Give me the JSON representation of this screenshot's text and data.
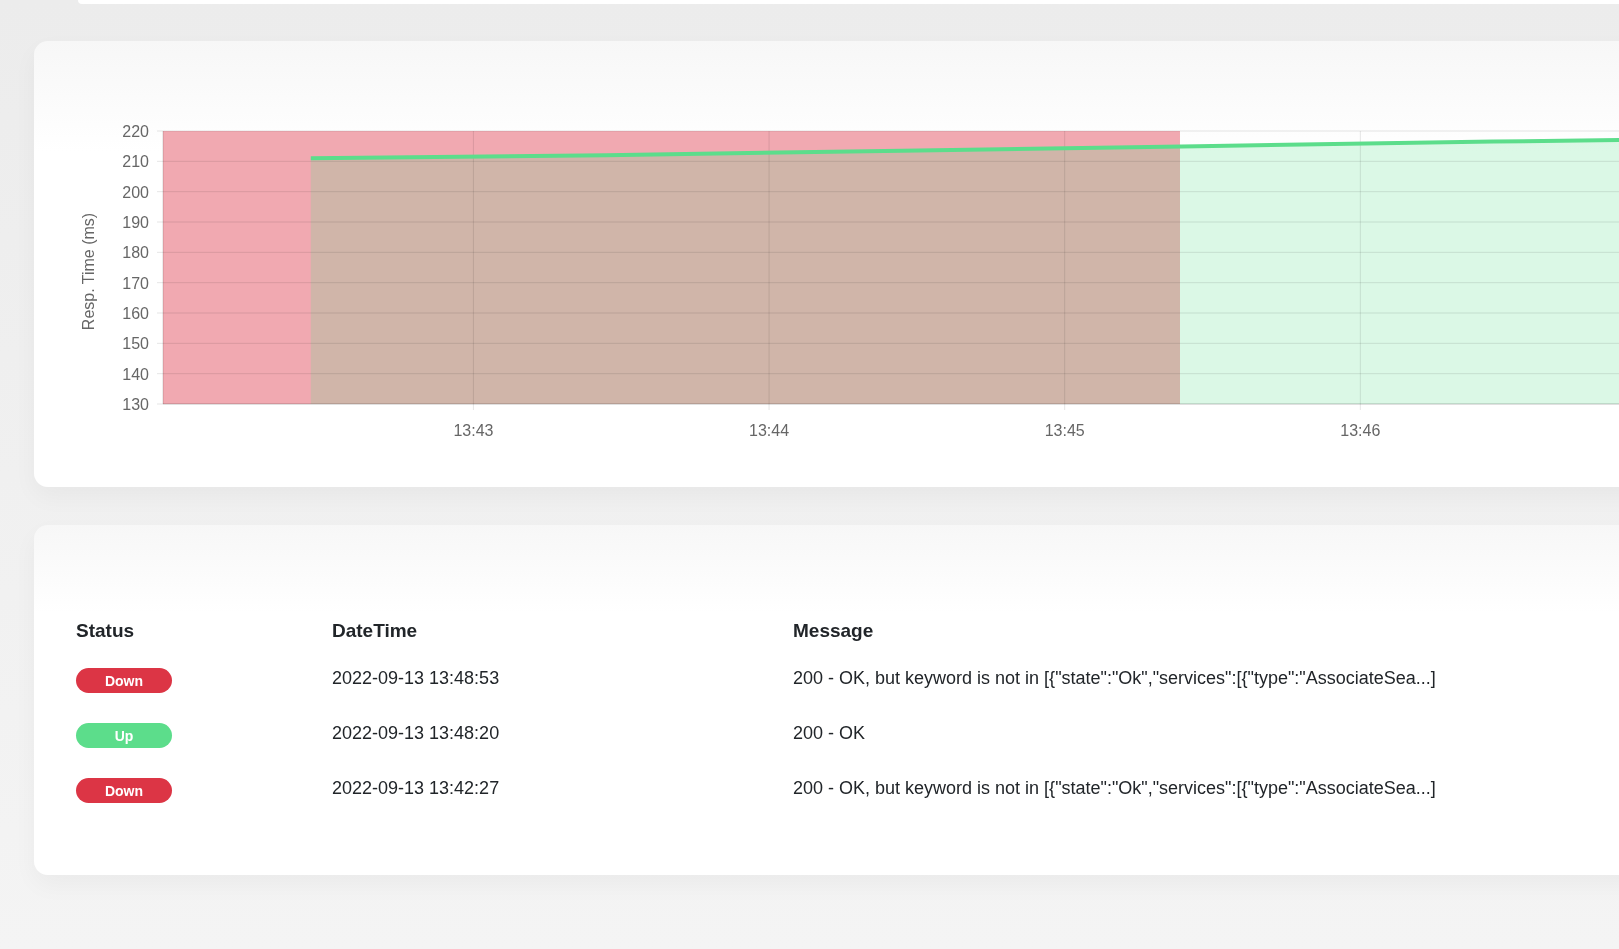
{
  "response_chart": {
    "chart_data": {
      "type": "area",
      "ylabel": "Resp. Time (ms)",
      "x": [
        822.45,
        823.45,
        824.45,
        825.45,
        826.45,
        826.875
      ],
      "series": [
        {
          "color": "#5cdd8b",
          "values": [
            211,
            212,
            213.5,
            215,
            216.5,
            217
          ]
        }
      ],
      "xlim": [
        821.95,
        826.875
      ],
      "ylim": [
        130,
        220
      ],
      "xticks": [
        {
          "value": 823,
          "label": "13:43"
        },
        {
          "value": 824,
          "label": "13:44"
        },
        {
          "value": 825,
          "label": "13:45"
        },
        {
          "value": 826,
          "label": "13:46"
        }
      ],
      "yticks": [
        130,
        140,
        150,
        160,
        170,
        180,
        190,
        200,
        210,
        220
      ],
      "grid": true,
      "bands": [
        {
          "axis": "x",
          "from": 821.95,
          "to": 825.39,
          "color": "#f1a9b1"
        }
      ]
    }
  },
  "events_table": {
    "columns": [
      "Status",
      "DateTime",
      "Message"
    ],
    "rows": [
      {
        "status": "Down",
        "color": "#dc3545",
        "datetime": "2022-09-13 13:48:53",
        "message": "200 - OK, but keyword is not in [{\"state\":\"Ok\",\"services\":[{\"type\":\"AssociateSea...]"
      },
      {
        "status": "Up",
        "color": "#5cdd8b",
        "datetime": "2022-09-13 13:48:20",
        "message": "200 - OK"
      },
      {
        "status": "Down",
        "color": "#dc3545",
        "datetime": "2022-09-13 13:42:27",
        "message": "200 - OK, but keyword is not in [{\"state\":\"Ok\",\"services\":[{\"type\":\"AssociateSea...]"
      }
    ]
  }
}
